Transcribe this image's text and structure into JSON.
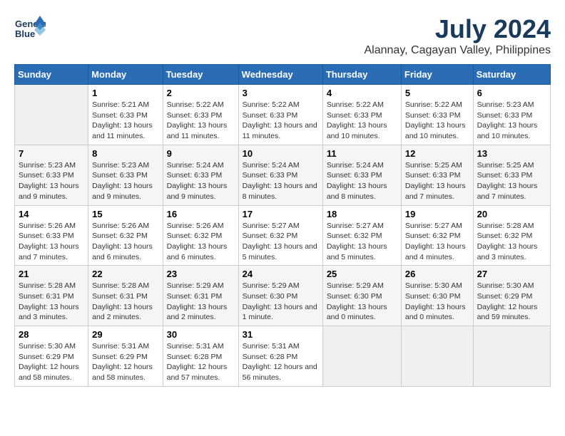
{
  "header": {
    "logo_line1": "General",
    "logo_line2": "Blue",
    "month_year": "July 2024",
    "location": "Alannay, Cagayan Valley, Philippines"
  },
  "weekdays": [
    "Sunday",
    "Monday",
    "Tuesday",
    "Wednesday",
    "Thursday",
    "Friday",
    "Saturday"
  ],
  "weeks": [
    [
      {
        "day": "",
        "sunrise": "",
        "sunset": "",
        "daylight": ""
      },
      {
        "day": "1",
        "sunrise": "Sunrise: 5:21 AM",
        "sunset": "Sunset: 6:33 PM",
        "daylight": "Daylight: 13 hours and 11 minutes."
      },
      {
        "day": "2",
        "sunrise": "Sunrise: 5:22 AM",
        "sunset": "Sunset: 6:33 PM",
        "daylight": "Daylight: 13 hours and 11 minutes."
      },
      {
        "day": "3",
        "sunrise": "Sunrise: 5:22 AM",
        "sunset": "Sunset: 6:33 PM",
        "daylight": "Daylight: 13 hours and 11 minutes."
      },
      {
        "day": "4",
        "sunrise": "Sunrise: 5:22 AM",
        "sunset": "Sunset: 6:33 PM",
        "daylight": "Daylight: 13 hours and 10 minutes."
      },
      {
        "day": "5",
        "sunrise": "Sunrise: 5:22 AM",
        "sunset": "Sunset: 6:33 PM",
        "daylight": "Daylight: 13 hours and 10 minutes."
      },
      {
        "day": "6",
        "sunrise": "Sunrise: 5:23 AM",
        "sunset": "Sunset: 6:33 PM",
        "daylight": "Daylight: 13 hours and 10 minutes."
      }
    ],
    [
      {
        "day": "7",
        "sunrise": "Sunrise: 5:23 AM",
        "sunset": "Sunset: 6:33 PM",
        "daylight": "Daylight: 13 hours and 9 minutes."
      },
      {
        "day": "8",
        "sunrise": "Sunrise: 5:23 AM",
        "sunset": "Sunset: 6:33 PM",
        "daylight": "Daylight: 13 hours and 9 minutes."
      },
      {
        "day": "9",
        "sunrise": "Sunrise: 5:24 AM",
        "sunset": "Sunset: 6:33 PM",
        "daylight": "Daylight: 13 hours and 9 minutes."
      },
      {
        "day": "10",
        "sunrise": "Sunrise: 5:24 AM",
        "sunset": "Sunset: 6:33 PM",
        "daylight": "Daylight: 13 hours and 8 minutes."
      },
      {
        "day": "11",
        "sunrise": "Sunrise: 5:24 AM",
        "sunset": "Sunset: 6:33 PM",
        "daylight": "Daylight: 13 hours and 8 minutes."
      },
      {
        "day": "12",
        "sunrise": "Sunrise: 5:25 AM",
        "sunset": "Sunset: 6:33 PM",
        "daylight": "Daylight: 13 hours and 7 minutes."
      },
      {
        "day": "13",
        "sunrise": "Sunrise: 5:25 AM",
        "sunset": "Sunset: 6:33 PM",
        "daylight": "Daylight: 13 hours and 7 minutes."
      }
    ],
    [
      {
        "day": "14",
        "sunrise": "Sunrise: 5:26 AM",
        "sunset": "Sunset: 6:33 PM",
        "daylight": "Daylight: 13 hours and 7 minutes."
      },
      {
        "day": "15",
        "sunrise": "Sunrise: 5:26 AM",
        "sunset": "Sunset: 6:32 PM",
        "daylight": "Daylight: 13 hours and 6 minutes."
      },
      {
        "day": "16",
        "sunrise": "Sunrise: 5:26 AM",
        "sunset": "Sunset: 6:32 PM",
        "daylight": "Daylight: 13 hours and 6 minutes."
      },
      {
        "day": "17",
        "sunrise": "Sunrise: 5:27 AM",
        "sunset": "Sunset: 6:32 PM",
        "daylight": "Daylight: 13 hours and 5 minutes."
      },
      {
        "day": "18",
        "sunrise": "Sunrise: 5:27 AM",
        "sunset": "Sunset: 6:32 PM",
        "daylight": "Daylight: 13 hours and 5 minutes."
      },
      {
        "day": "19",
        "sunrise": "Sunrise: 5:27 AM",
        "sunset": "Sunset: 6:32 PM",
        "daylight": "Daylight: 13 hours and 4 minutes."
      },
      {
        "day": "20",
        "sunrise": "Sunrise: 5:28 AM",
        "sunset": "Sunset: 6:32 PM",
        "daylight": "Daylight: 13 hours and 3 minutes."
      }
    ],
    [
      {
        "day": "21",
        "sunrise": "Sunrise: 5:28 AM",
        "sunset": "Sunset: 6:31 PM",
        "daylight": "Daylight: 13 hours and 3 minutes."
      },
      {
        "day": "22",
        "sunrise": "Sunrise: 5:28 AM",
        "sunset": "Sunset: 6:31 PM",
        "daylight": "Daylight: 13 hours and 2 minutes."
      },
      {
        "day": "23",
        "sunrise": "Sunrise: 5:29 AM",
        "sunset": "Sunset: 6:31 PM",
        "daylight": "Daylight: 13 hours and 2 minutes."
      },
      {
        "day": "24",
        "sunrise": "Sunrise: 5:29 AM",
        "sunset": "Sunset: 6:30 PM",
        "daylight": "Daylight: 13 hours and 1 minute."
      },
      {
        "day": "25",
        "sunrise": "Sunrise: 5:29 AM",
        "sunset": "Sunset: 6:30 PM",
        "daylight": "Daylight: 13 hours and 0 minutes."
      },
      {
        "day": "26",
        "sunrise": "Sunrise: 5:30 AM",
        "sunset": "Sunset: 6:30 PM",
        "daylight": "Daylight: 13 hours and 0 minutes."
      },
      {
        "day": "27",
        "sunrise": "Sunrise: 5:30 AM",
        "sunset": "Sunset: 6:29 PM",
        "daylight": "Daylight: 12 hours and 59 minutes."
      }
    ],
    [
      {
        "day": "28",
        "sunrise": "Sunrise: 5:30 AM",
        "sunset": "Sunset: 6:29 PM",
        "daylight": "Daylight: 12 hours and 58 minutes."
      },
      {
        "day": "29",
        "sunrise": "Sunrise: 5:31 AM",
        "sunset": "Sunset: 6:29 PM",
        "daylight": "Daylight: 12 hours and 58 minutes."
      },
      {
        "day": "30",
        "sunrise": "Sunrise: 5:31 AM",
        "sunset": "Sunset: 6:28 PM",
        "daylight": "Daylight: 12 hours and 57 minutes."
      },
      {
        "day": "31",
        "sunrise": "Sunrise: 5:31 AM",
        "sunset": "Sunset: 6:28 PM",
        "daylight": "Daylight: 12 hours and 56 minutes."
      },
      {
        "day": "",
        "sunrise": "",
        "sunset": "",
        "daylight": ""
      },
      {
        "day": "",
        "sunrise": "",
        "sunset": "",
        "daylight": ""
      },
      {
        "day": "",
        "sunrise": "",
        "sunset": "",
        "daylight": ""
      }
    ]
  ]
}
